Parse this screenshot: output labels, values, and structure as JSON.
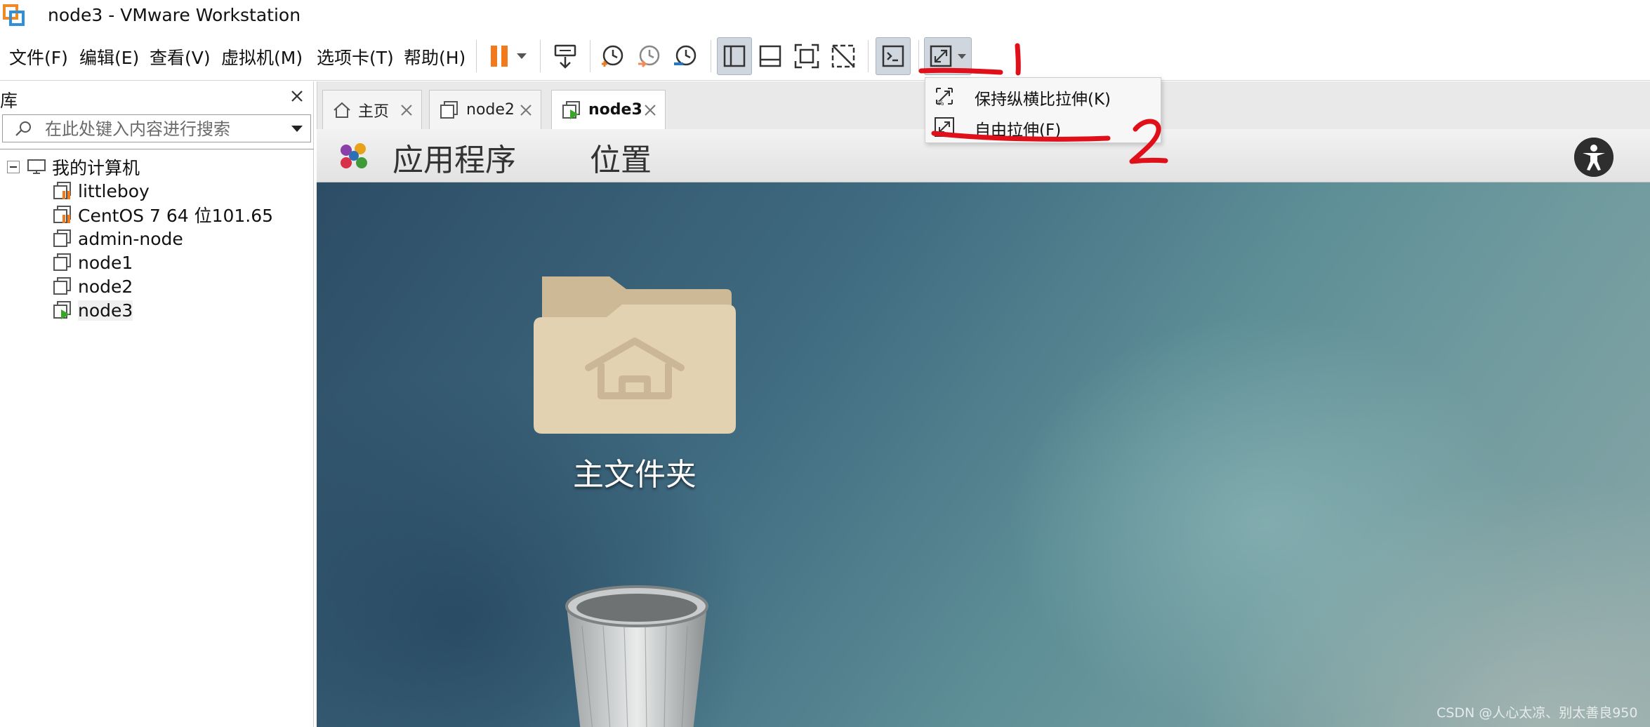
{
  "window": {
    "title": "node3 - VMware Workstation"
  },
  "menu": [
    "文件(F)",
    "编辑(E)",
    "查看(V)",
    "虚拟机(M)",
    "选项卡(T)",
    "帮助(H)"
  ],
  "toolbar": {
    "icons": [
      "pause-icon",
      "dropdown-arrow-icon",
      "send-ctrl-alt-del-icon",
      "snapshot-take-icon",
      "snapshot-revert-icon",
      "snapshot-manager-icon",
      "show-library-icon",
      "show-thumbnail-bar-icon",
      "full-screen-icon",
      "unity-icon",
      "console-view-icon",
      "stretch-icon",
      "stretch-dropdown-icon"
    ]
  },
  "library": {
    "title": "库",
    "search_placeholder": "在此处键入内容进行搜索",
    "root": "我的计算机",
    "items": [
      {
        "label": "littleboy",
        "state": "suspended"
      },
      {
        "label": "CentOS 7 64 位101.65",
        "state": "suspended"
      },
      {
        "label": "admin-node",
        "state": "off"
      },
      {
        "label": "node1",
        "state": "off"
      },
      {
        "label": "node2",
        "state": "off"
      },
      {
        "label": "node3",
        "state": "running"
      }
    ]
  },
  "tabs": [
    {
      "label": "主页",
      "icon": "home-icon",
      "active": false
    },
    {
      "label": "node2",
      "icon": "vm-icon",
      "active": false
    },
    {
      "label": "node3",
      "icon": "vm-running-icon",
      "active": true
    }
  ],
  "guest": {
    "menus": [
      "应用程序",
      "位置"
    ],
    "desktop_icons": [
      {
        "label": "主文件夹",
        "icon": "home-folder-icon"
      },
      {
        "label": "",
        "icon": "trash-icon"
      }
    ]
  },
  "stretch_menu": {
    "items": [
      {
        "label": "保持纵横比拉伸(K)",
        "icon": "keep-aspect-stretch-icon"
      },
      {
        "label": "自由拉伸(F)",
        "icon": "free-stretch-icon"
      }
    ]
  },
  "annotations": [
    "1",
    "2"
  ],
  "watermark": "CSDN @人心太凉、别太善良950",
  "colors": {
    "annotation_red": "#e0101a",
    "pause_orange": "#f07a1c",
    "running_green": "#3aa52a"
  }
}
